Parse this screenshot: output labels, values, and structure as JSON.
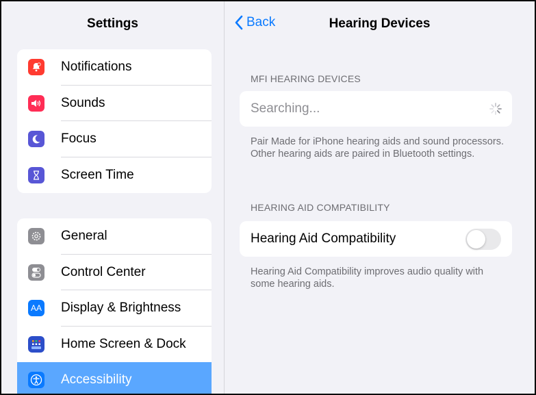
{
  "sidebar": {
    "title": "Settings",
    "group1": [
      {
        "label": "Notifications",
        "icon": "bell-icon",
        "color": "#ff3b30"
      },
      {
        "label": "Sounds",
        "icon": "speaker-icon",
        "color": "#ff2d55"
      },
      {
        "label": "Focus",
        "icon": "moon-icon",
        "color": "#5856d6"
      },
      {
        "label": "Screen Time",
        "icon": "hourglass-icon",
        "color": "#5856d6"
      }
    ],
    "group2": [
      {
        "label": "General",
        "icon": "gear-icon",
        "color": "#8e8e93"
      },
      {
        "label": "Control Center",
        "icon": "switches-icon",
        "color": "#8e8e93"
      },
      {
        "label": "Display & Brightness",
        "icon": "text-size-icon",
        "color": "#0a7aff",
        "glyph": "AA"
      },
      {
        "label": "Home Screen & Dock",
        "icon": "grid-icon",
        "color": "#2c4ec9"
      },
      {
        "label": "Accessibility",
        "icon": "accessibility-icon",
        "color": "#0a7aff",
        "selected": true
      }
    ]
  },
  "detail": {
    "back_label": "Back",
    "title": "Hearing Devices",
    "mfi_header": "MFI HEARING DEVICES",
    "searching": "Searching...",
    "mfi_footer": "Pair Made for iPhone hearing aids and sound processors. Other hearing aids are paired in Bluetooth settings.",
    "hac_header": "HEARING AID COMPATIBILITY",
    "hac_label": "Hearing Aid Compatibility",
    "hac_on": false,
    "hac_footer": "Hearing Aid Compatibility improves audio quality with some hearing aids."
  },
  "colors": {
    "accent": "#0a7aff",
    "selected_row": "#5aa7ff"
  }
}
